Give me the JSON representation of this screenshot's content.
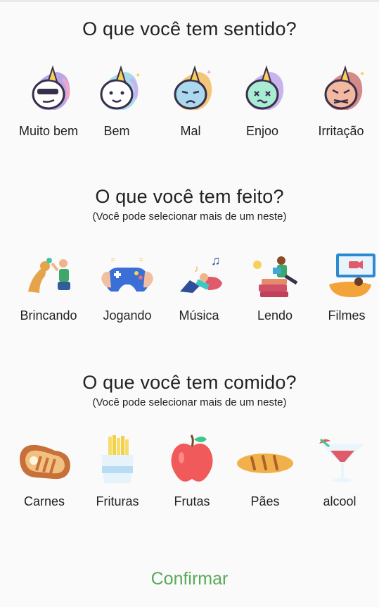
{
  "sections": [
    {
      "title": "O que você tem sentido?",
      "subtitle": "",
      "items": [
        {
          "label": "Muito bem",
          "icon": "unicorn-cool-icon"
        },
        {
          "label": "Bem",
          "icon": "unicorn-happy-icon"
        },
        {
          "label": "Mal",
          "icon": "unicorn-sad-icon"
        },
        {
          "label": "Enjoo",
          "icon": "unicorn-sick-icon"
        },
        {
          "label": "Irritação",
          "icon": "unicorn-annoyed-icon"
        }
      ]
    },
    {
      "title": "O que você tem feito?",
      "subtitle": "(Você pode selecionar mais de um neste)",
      "items": [
        {
          "label": "Brincando",
          "icon": "playing-with-dog-icon"
        },
        {
          "label": "Jogando",
          "icon": "game-controller-icon"
        },
        {
          "label": "Música",
          "icon": "music-listening-icon"
        },
        {
          "label": "Lendo",
          "icon": "reading-books-icon"
        },
        {
          "label": "Filmes",
          "icon": "movies-tv-icon"
        }
      ]
    },
    {
      "title": "O que você tem comido?",
      "subtitle": "(Você pode selecionar mais de um neste)",
      "items": [
        {
          "label": "Carnes",
          "icon": "steak-icon"
        },
        {
          "label": "Frituras",
          "icon": "french-fries-icon"
        },
        {
          "label": "Frutas",
          "icon": "apple-icon"
        },
        {
          "label": "Pães",
          "icon": "bread-icon"
        },
        {
          "label": "alcool",
          "icon": "cocktail-icon"
        }
      ]
    }
  ],
  "confirm_label": "Confirmar",
  "colors": {
    "confirm": "#5aa95a"
  }
}
